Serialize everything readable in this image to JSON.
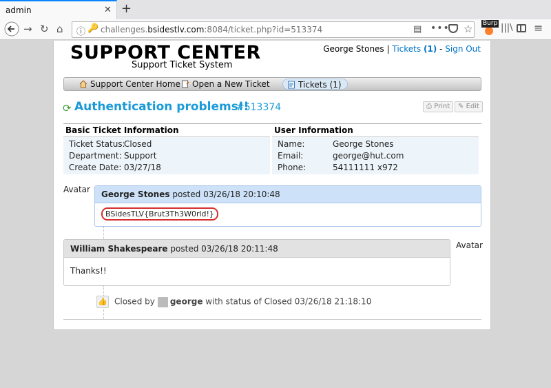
{
  "browser": {
    "tab_title": "admin",
    "url_prefix": "challenges.",
    "url_domain": "bsidestlv.com",
    "url_suffix": ":8084/ticket.php?id=513374",
    "burp_label": "Burp"
  },
  "header": {
    "logo_title": "SUPPORT CENTER",
    "logo_subtitle": "Support Ticket System",
    "user_name": "George Stones",
    "tickets_link": "Tickets",
    "tickets_count": "(1)",
    "signout_link": "Sign Out"
  },
  "nav": {
    "home": "Support Center Home",
    "new_ticket": "Open a New Ticket",
    "tickets": "Tickets (1)"
  },
  "ticket": {
    "title": "Authentication problems!!",
    "number": "#513374",
    "print_label": "Print",
    "edit_label": "Edit"
  },
  "basic_info": {
    "heading": "Basic Ticket Information",
    "rows": [
      {
        "key": "Ticket Status:",
        "value": "Closed"
      },
      {
        "key": "Department:",
        "value": "Support"
      },
      {
        "key": "Create Date:",
        "value": "03/27/18"
      }
    ]
  },
  "user_info": {
    "heading": "User Information",
    "rows": [
      {
        "key": "Name:",
        "value": "George Stones"
      },
      {
        "key": "Email:",
        "value": "george@hut.com"
      },
      {
        "key": "Phone:",
        "value": "54111111 x972"
      }
    ]
  },
  "thread": [
    {
      "avatar": "Avatar",
      "author": "George Stones",
      "meta": "posted 03/26/18 20:10:48",
      "body": "BSidesTLV{Brut3Th3W0rld!}"
    },
    {
      "avatar": "Avatar",
      "author": "William Shakespeare",
      "meta": "posted 03/26/18 20:11:48",
      "body": "Thanks!!"
    }
  ],
  "closed_event": {
    "prefix": "Closed by",
    "user": "george",
    "suffix": "with status of Closed 03/26/18 21:18:10"
  }
}
